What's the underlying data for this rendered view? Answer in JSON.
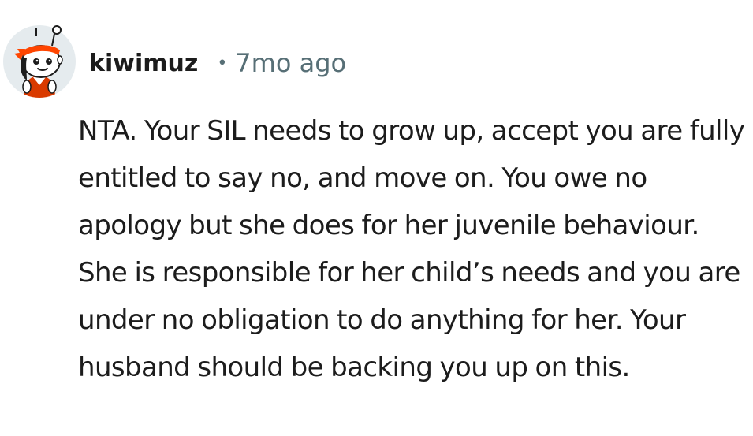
{
  "comment": {
    "author": "kiwimuz",
    "separator": "•",
    "timestamp": "7mo ago",
    "avatar_icon": "snoo-avatar-icon",
    "text": "NTA. Your SIL needs to grow up, accept you are fully entitled to say no, and move on. You owe no apology but she does for her juvenile behaviour. She is responsible for her child’s needs and you are under no obligation to do anything for her. Your husband should be backing you up on this."
  },
  "colors": {
    "text": "#1c1c1c",
    "meta": "#576f76",
    "avatar_bg": "#e5ebee",
    "headband": "#ff4500",
    "shirt": "#d93a00"
  }
}
